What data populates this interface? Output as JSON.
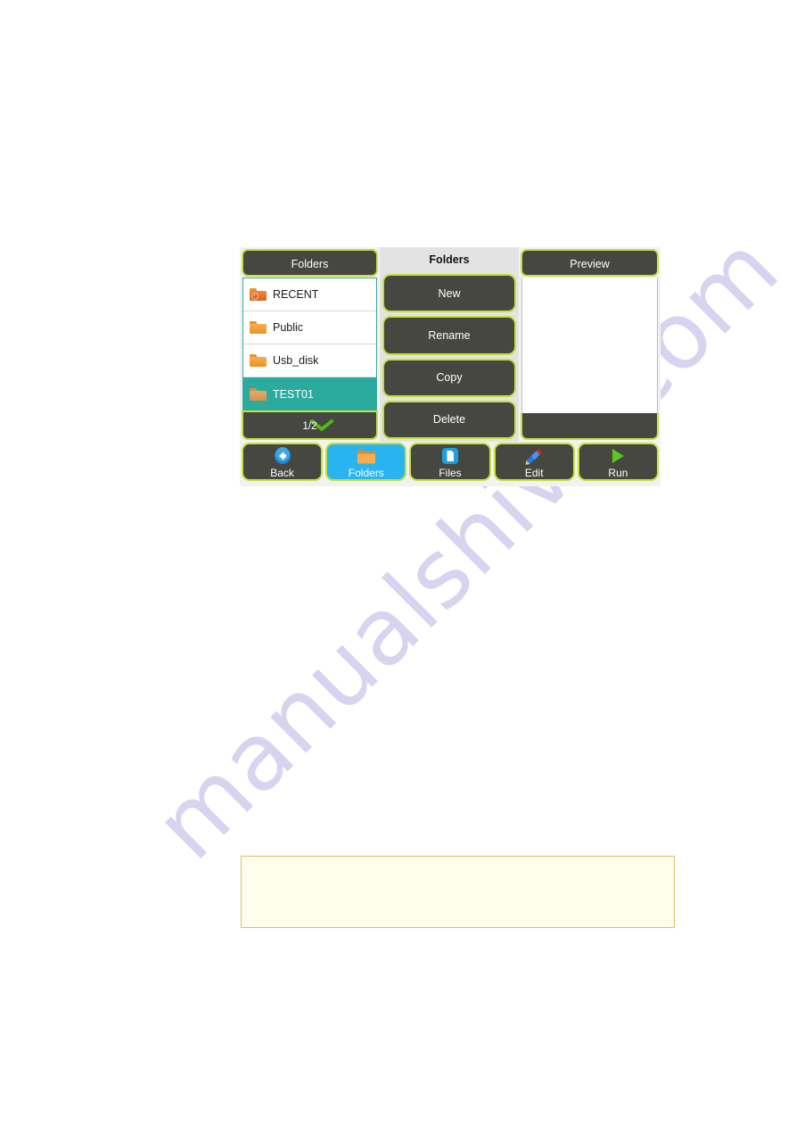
{
  "page": {
    "watermark": "manualshive.com"
  },
  "device": {
    "left_panel": {
      "header_title": "Folders",
      "items": [
        {
          "label": "RECENT",
          "icon": "recent-folder-icon",
          "selected": false
        },
        {
          "label": "Public",
          "icon": "folder-icon",
          "selected": false
        },
        {
          "label": "Usb_disk",
          "icon": "folder-icon",
          "selected": false
        },
        {
          "label": "TEST01",
          "icon": "folder-icon",
          "selected": true
        }
      ],
      "pager": {
        "chevron_icon": "chevron-down-icon",
        "label": "1/2"
      }
    },
    "middle_panel": {
      "title": "Folders",
      "buttons": [
        {
          "label": "New"
        },
        {
          "label": "Rename"
        },
        {
          "label": "Copy"
        },
        {
          "label": "Delete"
        }
      ]
    },
    "right_panel": {
      "header_title": "Preview",
      "body_content": ""
    },
    "toolbar": {
      "buttons": [
        {
          "label": "Back",
          "icon": "back-arrow-icon",
          "active": false
        },
        {
          "label": "Folders",
          "icon": "folder-icon",
          "active": true
        },
        {
          "label": "Files",
          "icon": "document-icon",
          "active": false
        },
        {
          "label": "Edit",
          "icon": "pencil-icon",
          "active": false
        },
        {
          "label": "Run",
          "icon": "play-triangle-icon",
          "active": false
        }
      ]
    }
  },
  "note_box": {
    "text": ""
  },
  "colors": {
    "panel_dark": "#464741",
    "border_lime": "#c3e03a",
    "selected_teal": "#2bab9e",
    "active_blue": "#2ab4ef",
    "folder_orange": "#ef9a2e",
    "run_green": "#5cc523",
    "note_fill": "#fffdeb",
    "note_border": "#e3bd68",
    "watermark": "#d6d4ef"
  }
}
